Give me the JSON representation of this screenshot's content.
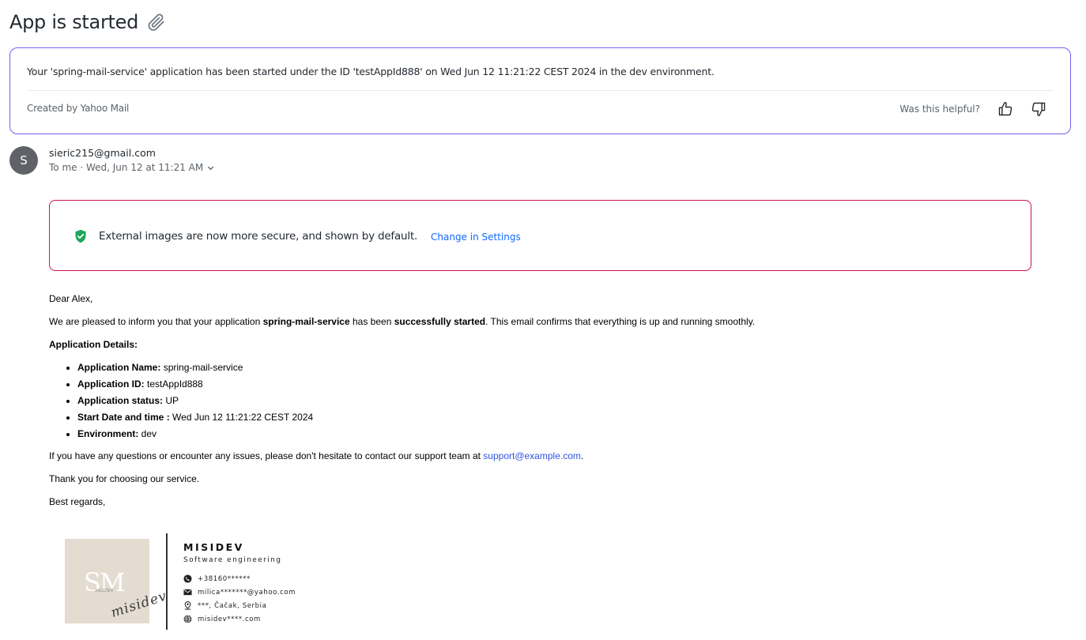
{
  "subject": "App is started",
  "summary": {
    "text": "Your 'spring-mail-service' application has been started under the ID 'testAppId888' on Wed Jun 12 11:21:22 CEST 2024 in the dev environment.",
    "credit": "Created by Yahoo Mail",
    "feedback_label": "Was this helpful?"
  },
  "sender": {
    "avatar_letter": "S",
    "email": "sieric215@gmail.com",
    "meta": "To me · Wed, Jun 12 at 11:21 AM"
  },
  "notice": {
    "text": "External images are now more secure, and shown by default.",
    "link": "Change in Settings"
  },
  "body": {
    "greeting": "Dear Alex,",
    "intro_pre": "We are pleased to inform you that your application ",
    "intro_app": "spring-mail-service",
    "intro_mid": " has been ",
    "intro_status": "successfully started",
    "intro_post": ". This email confirms that everything is up and running smoothly.",
    "details_heading": "Application Details:",
    "details": [
      {
        "label": "Application Name:",
        "value": " spring-mail-service"
      },
      {
        "label": "Application ID:",
        "value": " testAppId888"
      },
      {
        "label": "Application status:",
        "value": " UP"
      },
      {
        "label": " Start Date and time :",
        "value": " Wed Jun 12 11:21:22 CEST 2024"
      },
      {
        "label": "Environment:",
        "value": " dev"
      }
    ],
    "support_pre": "If you have any questions or encounter any issues, please don't hesitate to contact our support team at ",
    "support_email": "support@example.com",
    "support_post": ".",
    "thanks": "Thank you for choosing our service.",
    "closing": "Best regards,"
  },
  "signature": {
    "logo_text": "SM",
    "logo_small": "misidev",
    "script": "misidev",
    "name": "MISIDEV",
    "role": "Software engineering",
    "phone": "+38160******",
    "email": "milica*******@yahoo.com",
    "location": "***, Čačak, Serbia",
    "website": "misidev****.com"
  },
  "colors": {
    "summary_border": "#7b5cf0",
    "notice_border": "#d1144b",
    "link": "#0f69ff",
    "shield": "#1aa85a"
  }
}
